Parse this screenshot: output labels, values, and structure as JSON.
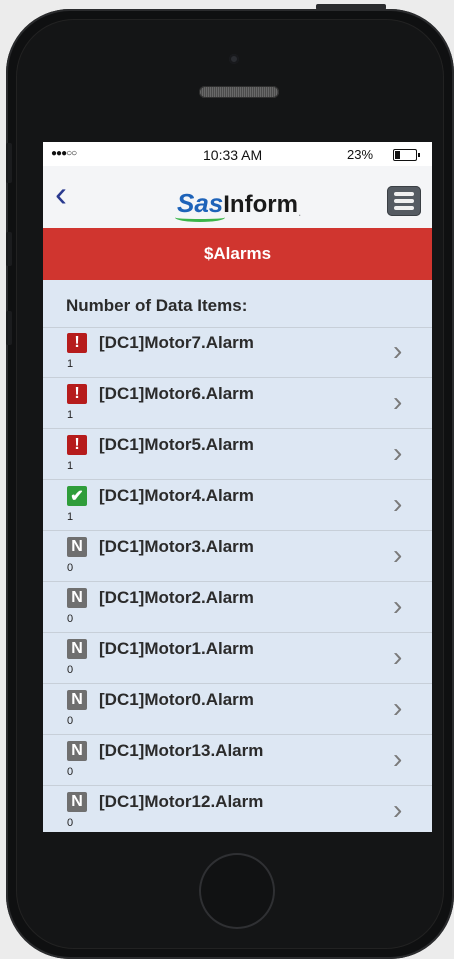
{
  "status_bar": {
    "signal": "●●●○○",
    "time": "10:33 AM",
    "battery_pct": "23%"
  },
  "header": {
    "back": "‹",
    "logo_sas": "Sas",
    "logo_inform": "Inform",
    "logo_dot": "."
  },
  "page": {
    "title": "$Alarms",
    "list_header": "Number of Data Items:"
  },
  "items": [
    {
      "label": "[DC1]Motor7.Alarm",
      "value": "1",
      "status": "alarm",
      "icon": "!"
    },
    {
      "label": "[DC1]Motor6.Alarm",
      "value": "1",
      "status": "alarm",
      "icon": "!"
    },
    {
      "label": "[DC1]Motor5.Alarm",
      "value": "1",
      "status": "alarm",
      "icon": "!"
    },
    {
      "label": "[DC1]Motor4.Alarm",
      "value": "1",
      "status": "ok",
      "icon": "✔"
    },
    {
      "label": "[DC1]Motor3.Alarm",
      "value": "0",
      "status": "normal",
      "icon": "N"
    },
    {
      "label": "[DC1]Motor2.Alarm",
      "value": "0",
      "status": "normal",
      "icon": "N"
    },
    {
      "label": "[DC1]Motor1.Alarm",
      "value": "0",
      "status": "normal",
      "icon": "N"
    },
    {
      "label": "[DC1]Motor0.Alarm",
      "value": "0",
      "status": "normal",
      "icon": "N"
    },
    {
      "label": "[DC1]Motor13.Alarm",
      "value": "0",
      "status": "normal",
      "icon": "N"
    },
    {
      "label": "[DC1]Motor12.Alarm",
      "value": "0",
      "status": "normal",
      "icon": "N"
    }
  ],
  "chevron": "›",
  "colors": {
    "accent_red": "#d0352f",
    "alarm": "#b61c1c",
    "ok": "#2f9d3a",
    "normal": "#6f6f6f",
    "list_bg": "#dde7f3"
  }
}
